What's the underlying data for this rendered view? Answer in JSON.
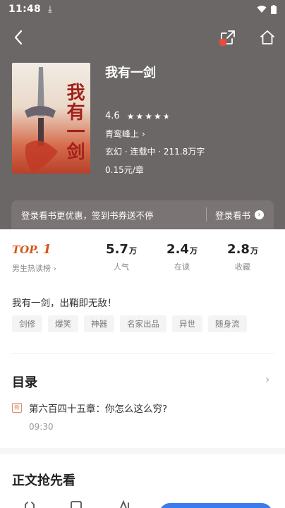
{
  "status_bar": {
    "time": "11:48",
    "download_glyph": "⤓"
  },
  "nav": {
    "back_icon": "chevron-left-icon",
    "share_icon": "share-icon",
    "home_icon": "home-icon"
  },
  "book": {
    "title": "我有一剑",
    "cover_title": "我有一剑",
    "rating": "4.6",
    "stars": 4.5,
    "author": "青鸾峰上",
    "meta": "玄幻 · 连载中 · 211.8万字",
    "price": "0.15元/章"
  },
  "login_banner": {
    "text": "登录看书更优惠，签到书券送不停",
    "button": "登录看书"
  },
  "stats": {
    "rank_top": "TOP.",
    "rank_num": "1",
    "rank_label": "男生热读榜",
    "popularity": {
      "value": "5.7",
      "unit": "万",
      "label": "人气"
    },
    "reading": {
      "value": "2.4",
      "unit": "万",
      "label": "在读"
    },
    "favorites": {
      "value": "2.8",
      "unit": "万",
      "label": "收藏"
    }
  },
  "description": "我有一剑，出鞘即无敌！",
  "tags": [
    "剑修",
    "爆笑",
    "神器",
    "名家出品",
    "异世",
    "随身流"
  ],
  "toc": {
    "title": "目录",
    "latest_badge": "新",
    "latest_chapter": "第六百四十五章：你怎么这么穷?",
    "latest_time": "09:30"
  },
  "preview": {
    "title": "正文抢先看"
  },
  "colors": {
    "hero_bg": "#6b6766",
    "rank_accent": "#d4561a",
    "primary_button": "#3a7bf0"
  }
}
